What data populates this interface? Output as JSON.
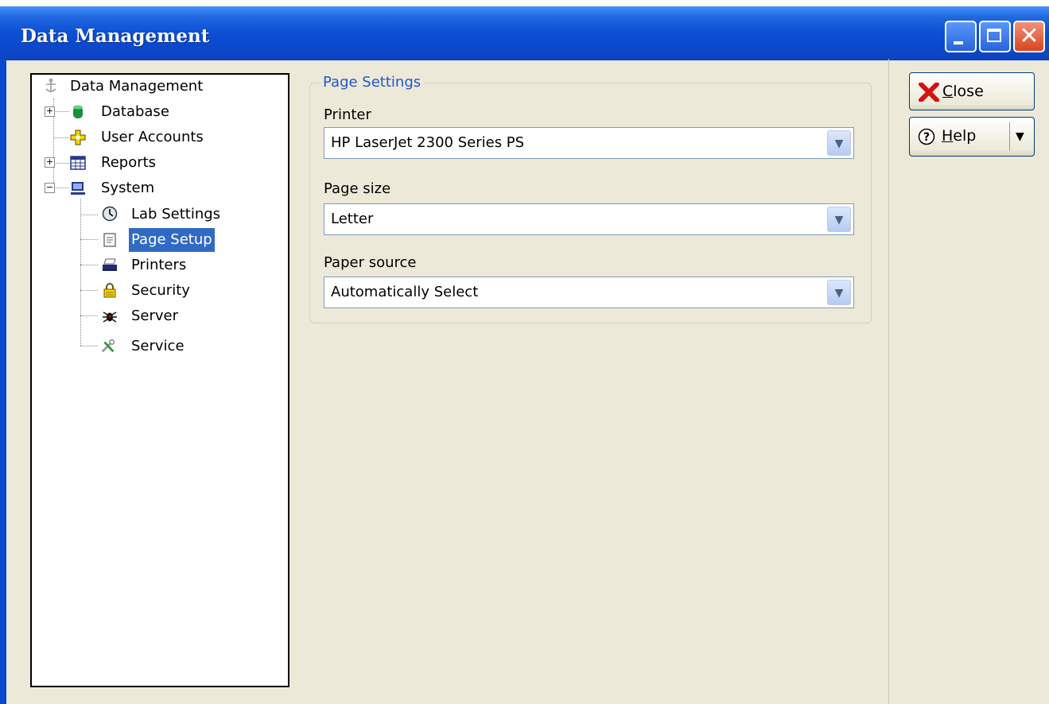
{
  "window": {
    "title": "Data Management",
    "controls": {
      "minimize": "minimize",
      "maximize": "maximize",
      "close": "close"
    }
  },
  "tree": {
    "items": [
      {
        "label": "Data Management",
        "icon": "anchor-icon",
        "level": 0
      },
      {
        "label": "Database",
        "icon": "database-icon",
        "level": 1,
        "expander": "+"
      },
      {
        "label": "User Accounts",
        "icon": "user-accounts-icon",
        "level": 1
      },
      {
        "label": "Reports",
        "icon": "reports-grid-icon",
        "level": 1,
        "expander": "+"
      },
      {
        "label": "System",
        "icon": "computer-icon",
        "level": 1,
        "expander": "−"
      },
      {
        "label": "Lab Settings",
        "icon": "clock-icon",
        "level": 2
      },
      {
        "label": "Page Setup",
        "icon": "page-icon",
        "level": 2,
        "selected": true
      },
      {
        "label": "Printers",
        "icon": "printer-icon",
        "level": 2
      },
      {
        "label": "Security",
        "icon": "lock-icon",
        "level": 2
      },
      {
        "label": "Server",
        "icon": "bug-icon",
        "level": 2
      },
      {
        "label": "Service",
        "icon": "tools-icon",
        "level": 2
      }
    ]
  },
  "page_settings": {
    "legend": "Page Settings",
    "printer": {
      "label": "Printer",
      "value": "HP LaserJet 2300 Series PS"
    },
    "page_size": {
      "label": "Page size",
      "value": "Letter"
    },
    "paper_source": {
      "label": "Paper source",
      "value": "Automatically Select"
    }
  },
  "buttons": {
    "close_label": "Close",
    "close_mnemonic": "C",
    "help_label": "Help",
    "help_mnemonic": "H"
  },
  "colors": {
    "titlebar": "#0a49cf",
    "selection": "#316ac5",
    "legend_text": "#2158c8",
    "window_bg": "#ece9d8"
  }
}
